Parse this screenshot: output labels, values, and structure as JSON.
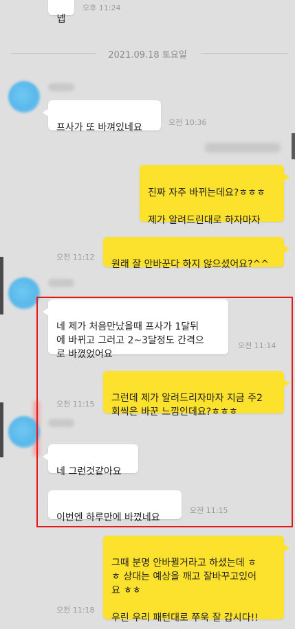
{
  "top": {
    "partial_bubble_text": "넵",
    "partial_time": "오후 11:24"
  },
  "date_separator": "2021.09.18 토요일",
  "messages": {
    "m1": {
      "text": "프사가 또 바껴있네요",
      "time": "오전 10:36"
    },
    "m2": {
      "text": "진짜 자주 바뀌는데요?ㅎㅎㅎ\n\n제가 알려드린대로 하자마자"
    },
    "m3": {
      "text": "원래 잘 안바꾼다 하지 않으셨어요?^^",
      "time": "오전 11:12"
    },
    "m4": {
      "text": "네 제가 처음만났을때 프사가 1달뒤\n에 바뀌고 그러고 2~3달정도 간격으\n로 바꼈었어요",
      "time": "오전 11:14"
    },
    "m5": {
      "text": "그런데 제가 알려드리자마자 지금 주2\n회씩은 바꾼 느낌인데요?ㅎㅎㅎ",
      "time": "오전 11:15"
    },
    "m6": {
      "text": "네 그런것같아요"
    },
    "m7": {
      "text": "이번엔 하루만에 바꼈네요",
      "time": "오전 11:15"
    },
    "m8": {
      "text": "그때 분명 안바뀔거라고 하셨는데 ㅎ\nㅎ 상대는 예상을 깨고 잘바꾸고있어\n요 ㅎㅎ\n\n우린 우리 패턴대로 쭈욱 잘 갑시다!!",
      "time": "오전 11:18"
    }
  },
  "colors": {
    "background": "#dfdfdf",
    "my_bubble": "#fce22c",
    "other_bubble": "#ffffff",
    "highlight_border": "#e4171b"
  }
}
